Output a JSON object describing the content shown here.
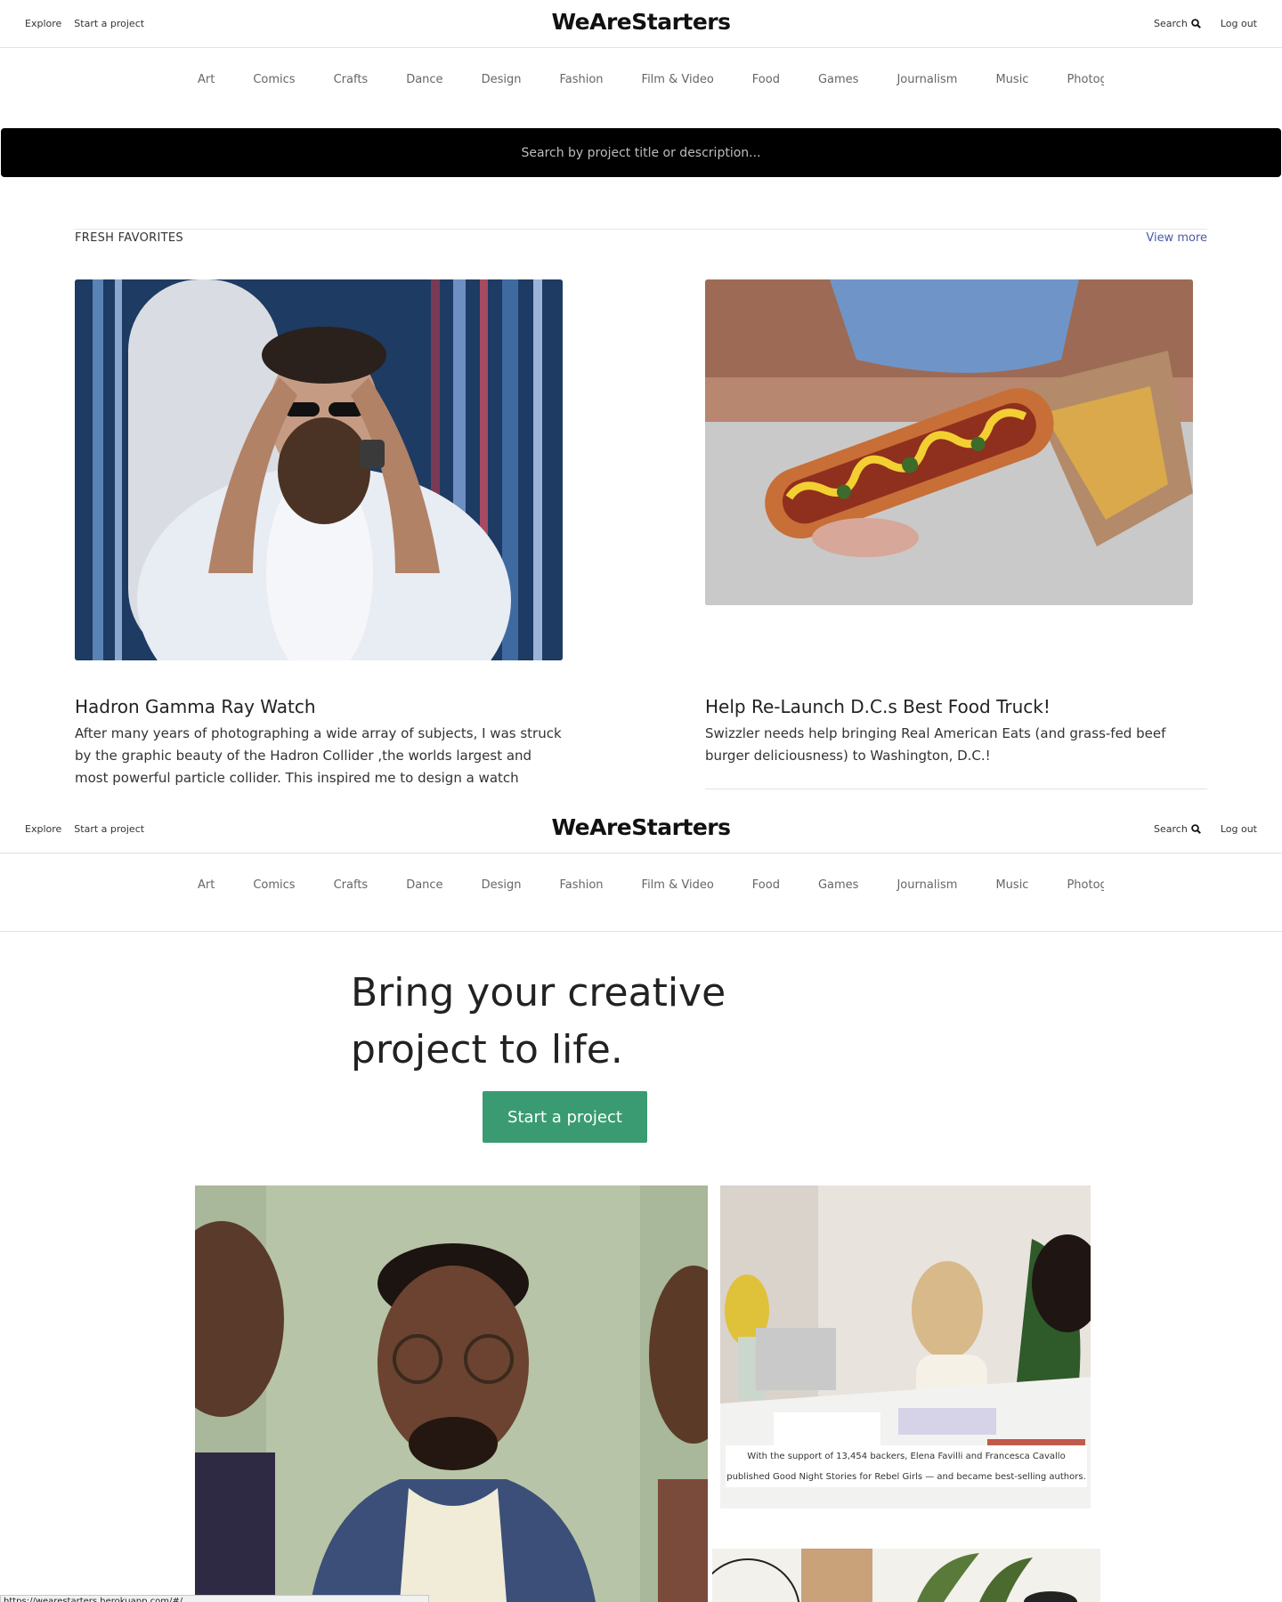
{
  "header": {
    "nav_left": [
      "Explore",
      "Start a project"
    ],
    "logo": "WeAreStarters",
    "search_label": "Search",
    "logout_label": "Log out"
  },
  "categories": [
    "Art",
    "Comics",
    "Crafts",
    "Dance",
    "Design",
    "Fashion",
    "Film & Video",
    "Food",
    "Games",
    "Journalism",
    "Music",
    "Photography"
  ],
  "search": {
    "placeholder": "Search by project title or description..."
  },
  "favorites": {
    "title": "FRESH FAVORITES",
    "view_more": "View more",
    "cards": [
      {
        "title": "Hadron Gamma Ray Watch",
        "description": "After many years of photographing a wide array of subjects, I was struck by the graphic beauty of the Hadron Collider ,the worlds largest and most powerful particle collider. This inspired me to design a watch devoted to its beauty .THE HARDRON GAMMA RAY.",
        "image": "bearded-man-photo"
      },
      {
        "title": "Help Re-Launch D.C.s Best Food Truck!",
        "description": "Swizzler needs help bringing Real American Eats (and grass-fed beef burger deliciousness) to Washington, D.C.!",
        "image": "hotdog-fries-photo"
      }
    ]
  },
  "hero": {
    "title_line1": "Bring your creative",
    "title_line2": "project to life.",
    "cta": "Start a project"
  },
  "gallery": {
    "caption_line1": "With the support of 13,454 backers, Elena Favilli and Francesca Cavallo",
    "caption_line2": "published Good Night Stories for Rebel Girls — and became best-selling authors."
  },
  "statusbar": {
    "url": "https://wearestarters.herokuapp.com/#/"
  },
  "colors": {
    "accent_green": "#3a9b72",
    "link_blue": "#4a5aa8",
    "search_bg": "#000000"
  }
}
